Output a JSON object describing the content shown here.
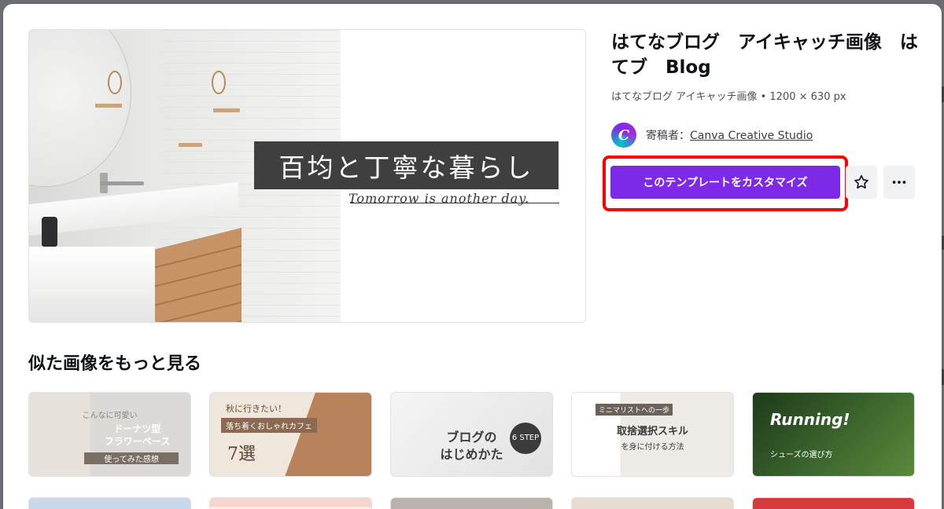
{
  "template": {
    "title": "はてなブログ　アイキャッチ画像　はてブ　Blog",
    "meta": "はてなブログ アイキャッチ画像 • 1200 × 630 px",
    "creator_prefix": "寄稿者：",
    "creator_name": "Canva Creative Studio",
    "customize_label": "このテンプレートをカスタマイズ"
  },
  "preview": {
    "headline": "百均と丁寧な暮らし",
    "tagline": "Tomorrow is another day."
  },
  "similar": {
    "heading": "似た画像をもっと見る",
    "thumbnails": [
      {
        "top": "こんなに可愛い",
        "main": "ドーナツ型\nフラワーベース",
        "sub": "使ってみた感想"
      },
      {
        "top": "秋に行きたい！",
        "main": "7選",
        "sub": "落ち着くおしゃれカフェ"
      },
      {
        "top": "",
        "main": "ブログの\nはじめかた",
        "sub": "6 STEP"
      },
      {
        "top": "ミニマリストへの一歩",
        "main": "取捨選択スキル",
        "sub": "を身に付ける方法"
      },
      {
        "top": "",
        "main": "Running!",
        "sub": "シューズの選び方"
      }
    ]
  },
  "icons": {
    "favorite": "star-icon",
    "more": "more-horizontal-icon",
    "creator": "canva-logo-icon"
  },
  "colors": {
    "accent": "#7d2ae8",
    "highlight": "#ff0000"
  }
}
